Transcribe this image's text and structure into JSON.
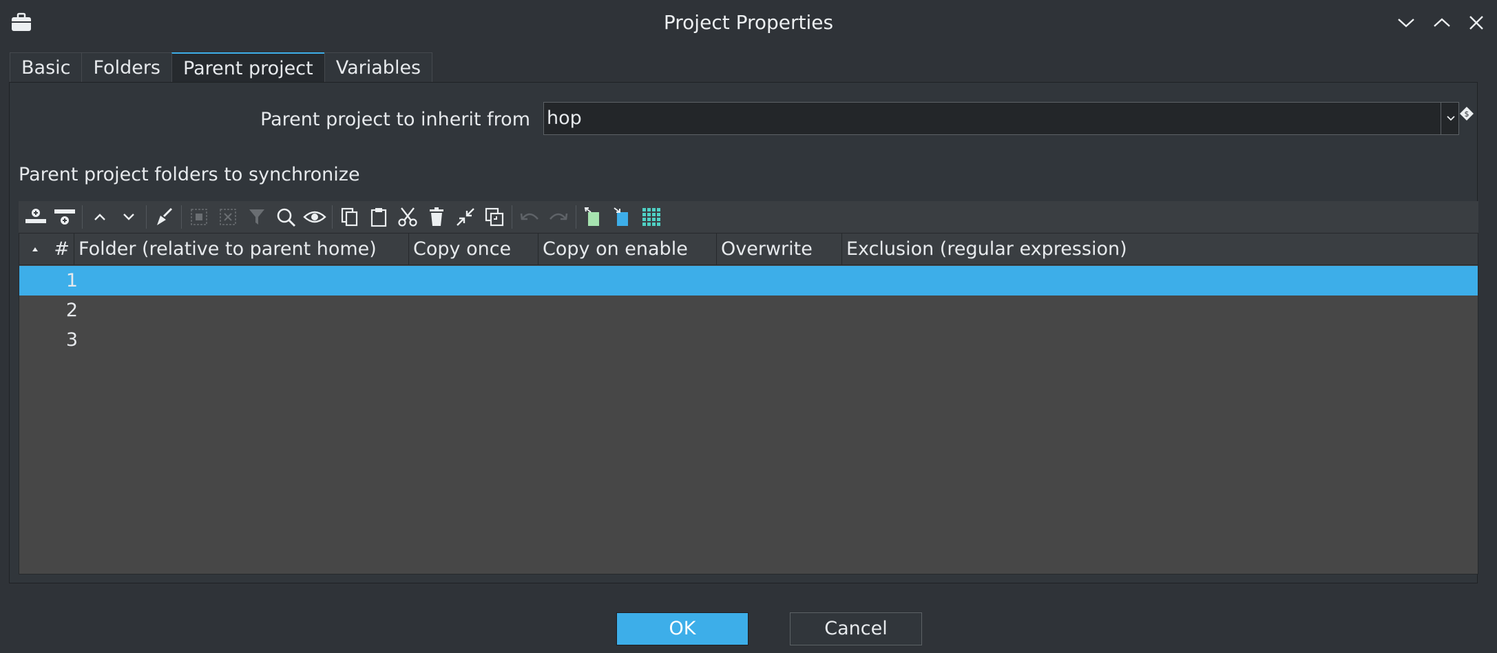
{
  "window": {
    "title": "Project Properties"
  },
  "tabs": [
    {
      "label": "Basic"
    },
    {
      "label": "Folders"
    },
    {
      "label": "Parent project"
    },
    {
      "label": "Variables"
    }
  ],
  "active_tab": "Parent project",
  "parent": {
    "label": "Parent project to inherit from",
    "value": "hop"
  },
  "sync": {
    "label": "Parent project folders to synchronize"
  },
  "table": {
    "columns": [
      "#",
      "Folder (relative to parent home)",
      "Copy once",
      "Copy on enable",
      "Overwrite",
      "Exclusion (regular expression)"
    ],
    "rows": [
      "1",
      "2",
      "3"
    ],
    "selected_row": "1"
  },
  "buttons": {
    "ok": "OK",
    "cancel": "Cancel"
  },
  "colors": {
    "accent": "#3daee9",
    "background": "#2f3338",
    "grid": "#474747"
  }
}
